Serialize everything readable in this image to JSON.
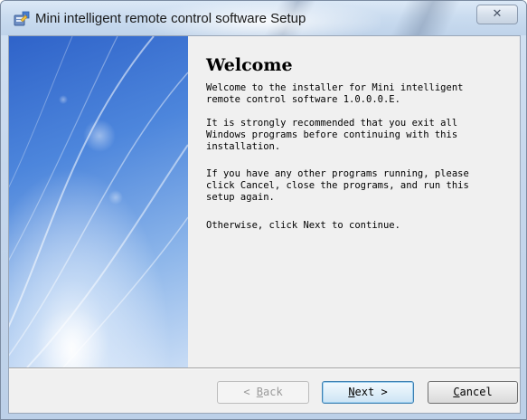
{
  "window": {
    "title": "Mini intelligent remote control software Setup",
    "close_glyph": "✕"
  },
  "icons": {
    "app": "installer-icon",
    "close": "close-icon"
  },
  "content": {
    "heading": "Welcome",
    "paragraphs": [
      "Welcome to the installer for Mini intelligent\nremote control software 1.0.0.0.E.",
      "It is strongly recommended that you exit all\nWindows programs before continuing with this\ninstallation.",
      "If you have any other programs running, please\nclick Cancel, close the programs, and run this\nsetup again.",
      "Otherwise, click Next to continue."
    ]
  },
  "buttons": {
    "back": {
      "prefix": "< ",
      "mnemonic": "B",
      "rest": "ack",
      "enabled": false
    },
    "next": {
      "mnemonic": "N",
      "rest": "ext >",
      "enabled": true
    },
    "cancel": {
      "mnemonic": "C",
      "rest": "ancel",
      "enabled": true
    }
  },
  "colors": {
    "sidebar_top": "#2f63c9",
    "sidebar_bottom": "#c8dcf5",
    "next_border": "#3c7fb1"
  }
}
